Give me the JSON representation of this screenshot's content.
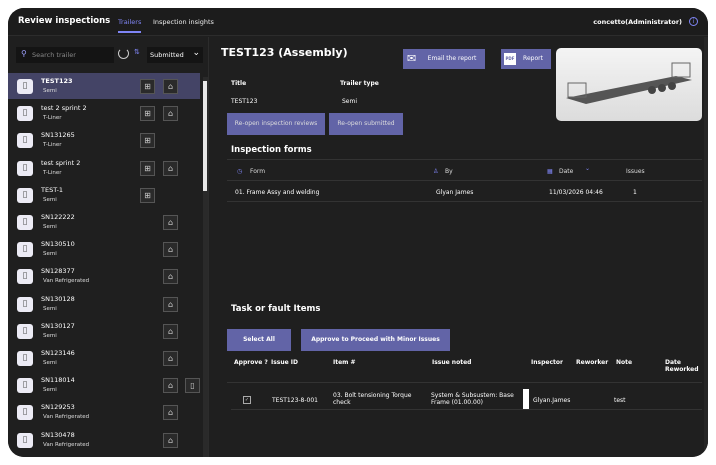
{
  "header": {
    "title": "Review inspections",
    "tabs": [
      {
        "label": "Trailers",
        "active": true
      },
      {
        "label": "Inspection insights",
        "active": false
      }
    ],
    "user": "concetto(Administrator)",
    "info_icon": "info-icon"
  },
  "sidebar": {
    "search_placeholder": "Search trailer",
    "filter": "Submitted",
    "items": [
      {
        "name": "TEST123",
        "type": "Semi",
        "selected": true,
        "icons": [
          "form",
          "robot-arm"
        ]
      },
      {
        "name": "test 2 sprint 2",
        "type": "T-Liner",
        "icons": [
          "form",
          "robot-arm"
        ]
      },
      {
        "name": "SN131265",
        "type": "T-Liner",
        "icons": [
          "form"
        ]
      },
      {
        "name": "test sprint 2",
        "type": "T-Liner",
        "icons": [
          "form",
          "robot-arm"
        ]
      },
      {
        "name": "TEST-1",
        "type": "Semi",
        "icons": [
          "form"
        ]
      },
      {
        "name": "SN122222",
        "type": "Semi",
        "icons": [
          "robot-arm"
        ]
      },
      {
        "name": "SN130510",
        "type": "Semi",
        "icons": [
          "robot-arm"
        ]
      },
      {
        "name": "SN128377",
        "type": "Van Refrigerated",
        "icons": [
          "robot-arm"
        ]
      },
      {
        "name": "SN130128",
        "type": "Semi",
        "icons": [
          "robot-arm"
        ]
      },
      {
        "name": "SN130127",
        "type": "Semi",
        "icons": [
          "robot-arm"
        ]
      },
      {
        "name": "SN123146",
        "type": "Semi",
        "icons": [
          "robot-arm"
        ]
      },
      {
        "name": "SN118014",
        "type": "Semi",
        "icons": [
          "robot-arm",
          "clipboard"
        ]
      },
      {
        "name": "SN129253",
        "type": "Van Refrigerated",
        "icons": [
          "robot-arm"
        ]
      },
      {
        "name": "SN130478",
        "type": "Van Refrigerated",
        "icons": [
          "robot-arm"
        ]
      }
    ]
  },
  "main": {
    "title": "TEST123 (Assembly)",
    "email_btn": "Email the report",
    "report_btn": "Report",
    "pdf_label": "PDF",
    "title_label": "Title",
    "title_value": "TEST123",
    "type_label": "Trailer type",
    "type_value": "Semi",
    "reopen_reviews": "Re-open inspection reviews",
    "reopen_submitted": "Re-open submitted",
    "forms_heading": "Inspection forms",
    "forms_columns": [
      "Form",
      "By",
      "Date",
      "Issues"
    ],
    "forms_rows": [
      [
        "01. Frame Assy and welding",
        "Glyan James",
        "11/03/2026 04:46",
        "1"
      ]
    ],
    "tasks_heading": "Task or fault Items",
    "select_all": "Select All",
    "approve_btn": "Approve to Proceed with Minor Issues",
    "task_columns": [
      "Approve ?",
      "Issue ID",
      "Item #",
      "Issue noted",
      "Inspector",
      "Reworker",
      "Note",
      "Date Reworked"
    ],
    "task_rows": [
      {
        "approved": true,
        "issue_id": "TEST123-8-001",
        "item": "03. Bolt tensioning Torque check",
        "issue": "System & Subsustem: Base Frame (01.00.00)",
        "inspector": "Glyan.James",
        "reworker": "",
        "note": "test",
        "date": ""
      }
    ]
  },
  "colors": {
    "accent": "#6264a7",
    "selected_row": "#444466",
    "background": "#1f1f1f"
  }
}
